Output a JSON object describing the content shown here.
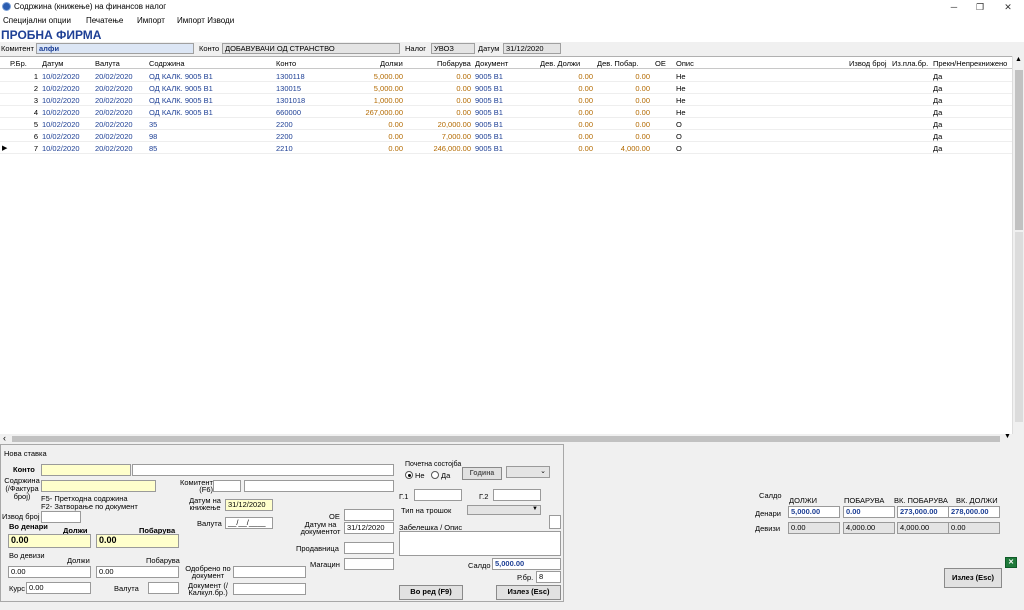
{
  "window": {
    "title": "Содржина (книжење) на финансов налог",
    "minimize": "─",
    "maximize": "❐",
    "close": "✕"
  },
  "menu": [
    "Специјални опции",
    "Печатење",
    "Импорт",
    "Импорт Изводи"
  ],
  "company": "ПРОБНА ФИРМА",
  "filter": {
    "komitent_label": "Комитент",
    "komitent_value": "алфи",
    "konto_label": "Конто",
    "konto_value": "ДОБАВУВАЧИ ОД СТРАНСТВО",
    "nalog_label": "Налог",
    "nalog_value": "УВОЗ",
    "datum_label": "Датум",
    "datum_value": "31/12/2020"
  },
  "grid": {
    "columns": [
      "Р.Бр.",
      "Датум",
      "Валута",
      "Содржина",
      "Конто",
      "Должи",
      "Побарува",
      "Документ",
      "Дев. Должи",
      "Дев. Побар.",
      "ОЕ",
      "Опис",
      "Извод број",
      "Из.пла.бр.",
      "Прекн/Непрекнижено"
    ],
    "rows": [
      {
        "rbr": "1",
        "datum": "10/02/2020",
        "valuta": "20/02/2020",
        "sodrzina": "ОД КАЛК. 9005  В1",
        "konto": "1300118",
        "dolzi": "5,000.00",
        "pobaruva": "0.00",
        "dokument": "9005  В1",
        "dev_dolzi": "0.00",
        "dev_pobar": "0.00",
        "oe": "",
        "opis": "Не",
        "izvod": "",
        "izpla": "",
        "prekn": "Да"
      },
      {
        "rbr": "2",
        "datum": "10/02/2020",
        "valuta": "20/02/2020",
        "sodrzina": "ОД КАЛК. 9005  В1",
        "konto": "130015",
        "dolzi": "5,000.00",
        "pobaruva": "0.00",
        "dokument": "9005  В1",
        "dev_dolzi": "0.00",
        "dev_pobar": "0.00",
        "oe": "",
        "opis": "Не",
        "izvod": "",
        "izpla": "",
        "prekn": "Да"
      },
      {
        "rbr": "3",
        "datum": "10/02/2020",
        "valuta": "20/02/2020",
        "sodrzina": "ОД КАЛК. 9005  В1",
        "konto": "1301018",
        "dolzi": "1,000.00",
        "pobaruva": "0.00",
        "dokument": "9005  В1",
        "dev_dolzi": "0.00",
        "dev_pobar": "0.00",
        "oe": "",
        "opis": "Не",
        "izvod": "",
        "izpla": "",
        "prekn": "Да"
      },
      {
        "rbr": "4",
        "datum": "10/02/2020",
        "valuta": "20/02/2020",
        "sodrzina": "ОД КАЛК. 9005  В1",
        "konto": "660000",
        "dolzi": "267,000.00",
        "pobaruva": "0.00",
        "dokument": "9005  В1",
        "dev_dolzi": "0.00",
        "dev_pobar": "0.00",
        "oe": "",
        "opis": "Не",
        "izvod": "",
        "izpla": "",
        "prekn": "Да"
      },
      {
        "rbr": "5",
        "datum": "10/02/2020",
        "valuta": "20/02/2020",
        "sodrzina": "35",
        "konto": "2200",
        "dolzi": "0.00",
        "pobaruva": "20,000.00",
        "dokument": "9005  В1",
        "dev_dolzi": "0.00",
        "dev_pobar": "0.00",
        "oe": "",
        "opis": "О",
        "izvod": "",
        "izpla": "",
        "prekn": "Да"
      },
      {
        "rbr": "6",
        "datum": "10/02/2020",
        "valuta": "20/02/2020",
        "sodrzina": "98",
        "konto": "2200",
        "dolzi": "0.00",
        "pobaruva": "7,000.00",
        "dokument": "9005  В1",
        "dev_dolzi": "0.00",
        "dev_pobar": "0.00",
        "oe": "",
        "opis": "О",
        "izvod": "",
        "izpla": "",
        "prekn": "Да"
      },
      {
        "rbr": "7",
        "datum": "10/02/2020",
        "valuta": "20/02/2020",
        "sodrzina": "85",
        "konto": "2210",
        "dolzi": "0.00",
        "pobaruva": "246,000.00",
        "dokument": "9005  В1",
        "dev_dolzi": "0.00",
        "dev_pobar": "4,000.00",
        "oe": "",
        "opis": "О",
        "izvod": "",
        "izpla": "",
        "prekn": "Да"
      }
    ],
    "current_row_marker": "▶"
  },
  "scroll": {
    "up": "▲",
    "down": "▼",
    "left": "‹",
    "right": "›"
  },
  "form": {
    "title": "Нова ставка",
    "konto_label": "Конто",
    "sodrzina_label": "Содржина (/Фактура број)",
    "hint_f5": "F5- Претходна содржина",
    "hint_f2": "F2- Затворање по документ",
    "izvod_label": "Извод број",
    "komitent_label": "Комитент (F6)",
    "datum_kniz_label": "Датум на книжење",
    "datum_kniz_value": "31/12/2020",
    "valuta_label": "Валута",
    "valuta_value": "__/__/____",
    "oe_label": "ОЕ",
    "datum_dok_label": "Датум на документот",
    "datum_dok_value": "31/12/2020",
    "denari_label": "Во денари",
    "dolzi_label": "Должи",
    "pobaruva_label": "Побарува",
    "dolzi_value": "0.00",
    "pobaruva_value": "0.00",
    "devizi_label": "Во девизи",
    "dev_dolzi_label": "Должи",
    "dev_pobaruva_label": "Побарува",
    "dev_dolzi_value": "0.00",
    "dev_pobaruva_value": "0.00",
    "kurs_label": "Курс",
    "kurs_value": "0.00",
    "valuta2_label": "Валута",
    "odobreno_label": "Одобрено по документ",
    "dokument_label": "Документ (/Калкул.бр.)",
    "prodavnica_label": "Продавница",
    "magacin_label": "Магацин",
    "pocetna_label": "Почетна состојба",
    "radio_ne": "Не",
    "radio_da": "Да",
    "godina_button": "Година",
    "g1_label": "Г.1",
    "g2_label": "Г.2",
    "tip_label": "Тип на трошок",
    "zabeleska_label": "Забелешка / Опис",
    "saldo_label": "Салдо",
    "saldo_value": "5,000.00",
    "rbr_label": "Р.бр.",
    "rbr_value": "8",
    "vo_red_button": "Во ред (F9)",
    "izlez_button": "Излез (Esc)"
  },
  "summary": {
    "saldo": "Салдо",
    "col_dolzi": "ДОЛЖИ",
    "col_pobaruva": "ПОБАРУВА",
    "col_vk_pobaruva": "ВК. ПОБАРУВА",
    "col_vk_dolzi": "ВК. ДОЛЖИ",
    "row_denari": "Денари",
    "row_devizi": "Девизи",
    "den_dolzi": "5,000.00",
    "den_pobaruva": "0.00",
    "den_vk_pobaruva": "273,000.00",
    "den_vk_dolzi": "278,000.00",
    "dev_dolzi": "0.00",
    "dev_pobaruva": "4,000.00",
    "dev_vk_pobaruva": "4,000.00",
    "dev_vk_dolzi": "0.00"
  },
  "exit_button": "Излез (Esc)",
  "colors": {
    "blue_text": "#1d3f95",
    "orange_value": "#b36a00",
    "highlight": "#ffffcc"
  }
}
